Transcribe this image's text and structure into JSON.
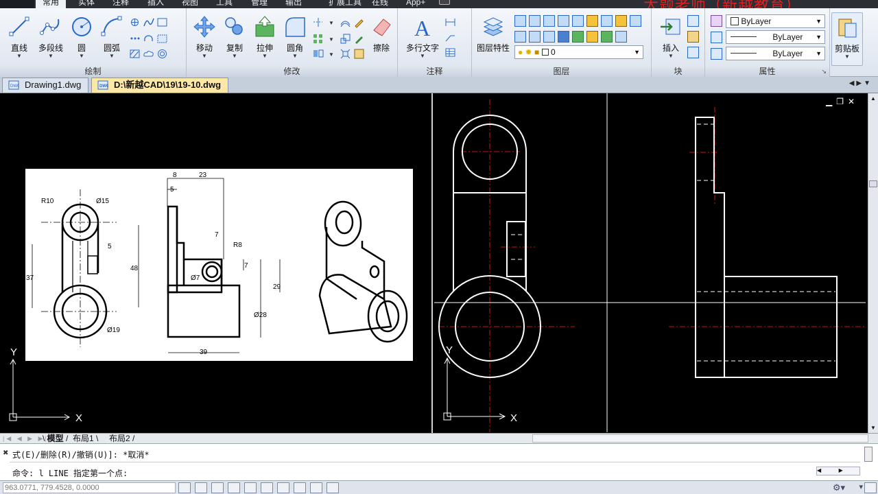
{
  "top_tabs": [
    "常用",
    "实体",
    "注释",
    "插入",
    "视图",
    "工具",
    "管理",
    "输出",
    "扩展工具",
    "在线",
    "App+"
  ],
  "watermark": "大题老师（新越教育）",
  "ribbon": {
    "draw_panel": {
      "title": "绘制",
      "buttons": [
        "直线",
        "多段线",
        "圆",
        "圆弧"
      ]
    },
    "modify_panel": {
      "title": "修改",
      "buttons": [
        "移动",
        "复制",
        "拉伸",
        "圆角",
        "擦除"
      ]
    },
    "annotate_panel": {
      "title": "注释",
      "buttons": [
        "多行文字"
      ]
    },
    "layer_panel": {
      "title": "图层",
      "buttons": [
        "图层特性"
      ],
      "current_layer": "0"
    },
    "block_panel": {
      "title": "块",
      "buttons": [
        "插入"
      ]
    },
    "properties_panel": {
      "title": "属性",
      "color": "ByLayer",
      "linetype": "ByLayer",
      "lineweight": "ByLayer"
    },
    "clipboard": {
      "label": "剪贴板"
    }
  },
  "doc_tabs": [
    {
      "label": "Drawing1.dwg",
      "active": false
    },
    {
      "label": "D:\\新越CAD\\19\\19-10.dwg",
      "active": true
    }
  ],
  "reference_drawing": {
    "dims": [
      "8",
      "23",
      "5",
      "R10",
      "Ø15",
      "5",
      "7",
      "R8",
      "48",
      "37",
      "Ø7",
      "7",
      "29",
      "Ø28",
      "39",
      "Ø19"
    ]
  },
  "ucs": {
    "x": "X",
    "y": "Y"
  },
  "layout_tabs": [
    "模型",
    "布局1",
    "布局2"
  ],
  "command_line": {
    "line1": "式(E)/删除(R)/撤销(U)]: *取消*",
    "line2": "命令: l LINE 指定第一个点:"
  },
  "status": {
    "coords": "963.0771, 779.4528, 0.0000"
  },
  "colors": {
    "accent": "#3a7bd5",
    "canvas": "#000000",
    "center_line": "#d01010",
    "geometry": "#ffffff"
  }
}
